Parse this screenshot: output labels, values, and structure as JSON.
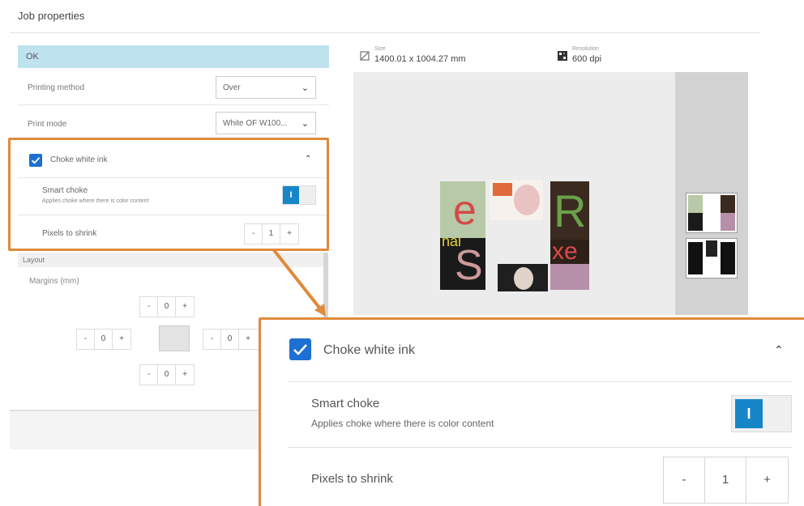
{
  "window": {
    "title": "Job properties"
  },
  "left": {
    "ok_label": "OK",
    "printing_method": {
      "label": "Printing method",
      "value": "Over"
    },
    "print_mode": {
      "label": "Print mode",
      "value": "White OF W100..."
    },
    "choke": {
      "checkbox_label": "Choke white ink",
      "smart_label": "Smart choke",
      "smart_desc": "Applies choke where there is color content",
      "pixels_label": "Pixels to shrink",
      "pixels_value": "1",
      "minus": "-",
      "plus": "+",
      "checked": true,
      "smart_on": true
    },
    "layout": {
      "header": "Layout",
      "margins_label": "Margins (mm)",
      "top": "0",
      "left": "0",
      "right": "0",
      "bottom": "0"
    }
  },
  "preview": {
    "size_caption": "Size",
    "size_value": "1400.01 x 1004.27 mm",
    "resolution_caption": "Resolution",
    "resolution_value": "600 dpi",
    "tiles": {
      "r": "R",
      "e": "e",
      "hai": "hai",
      "s": "S",
      "xe": "xe"
    }
  },
  "zoom": {
    "checkbox_label": "Choke white ink",
    "smart_label": "Smart choke",
    "smart_desc": "Applies choke where there is color content",
    "pixels_label": "Pixels to shrink",
    "pixels_value": "1",
    "toggle_glyph": "I"
  },
  "colors": {
    "accent": "#1686c8",
    "callout": "#e08a3b",
    "ok_bar": "#bfe2ef"
  }
}
